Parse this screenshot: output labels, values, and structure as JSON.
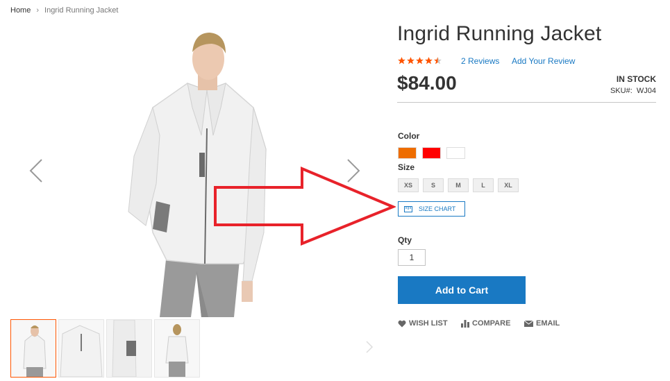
{
  "breadcrumb": {
    "home": "Home",
    "separator": "›",
    "current": "Ingrid Running Jacket"
  },
  "product": {
    "name": "Ingrid Running Jacket",
    "rating": {
      "value": 4.5,
      "max": 5,
      "color": "#ff5501"
    },
    "reviews_link": "2 Reviews",
    "add_review": "Add Your Review",
    "price": "$84.00",
    "stock": "IN STOCK",
    "sku_label": "SKU#:",
    "sku_value": "WJ04"
  },
  "options": {
    "color_label": "Color",
    "colors": [
      {
        "name": "Orange",
        "hex": "#ee6d00"
      },
      {
        "name": "Red",
        "hex": "#ff0000"
      },
      {
        "name": "White",
        "hex": "#ffffff"
      }
    ],
    "size_label": "Size",
    "sizes": [
      "XS",
      "S",
      "M",
      "L",
      "XL"
    ],
    "size_chart": "SIZE CHART"
  },
  "qty": {
    "label": "Qty",
    "value": "1"
  },
  "add_to_cart": "Add to Cart",
  "actions": {
    "wishlist": "WISH LIST",
    "compare": "COMPARE",
    "email": "EMAIL"
  },
  "gallery": {
    "thumbnail_count": 4,
    "active_thumbnail": 1
  },
  "colors": {
    "accent": "#1979c3",
    "rating": "#ff5501",
    "annotation_arrow": "#e8222a"
  }
}
